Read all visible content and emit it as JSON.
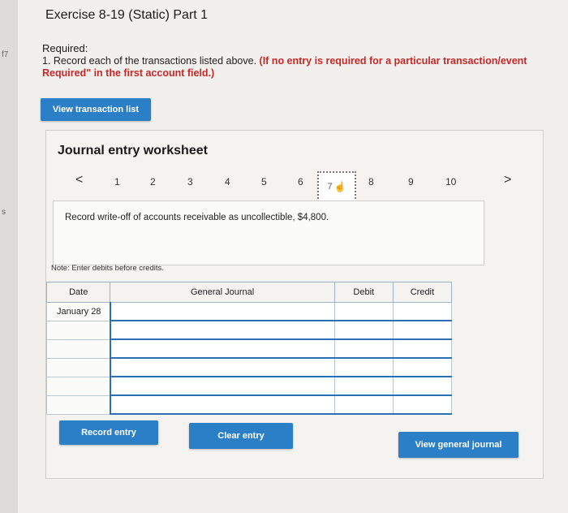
{
  "sidebar": {
    "marks": [
      "f7",
      "s"
    ]
  },
  "title": "Exercise 8-19 (Static) Part 1",
  "required": {
    "label": "Required:",
    "text": "1. Record each of the transactions listed above.",
    "emphasis": "(If no entry is required for a particular transaction/event",
    "line2": "Required\" in the first account field.)"
  },
  "buttons": {
    "view_transactions": "View transaction list",
    "record_entry": "Record entry",
    "clear_entry": "Clear entry",
    "view_general_journal": "View general journal"
  },
  "worksheet": {
    "title": "Journal entry worksheet",
    "prev_arrow": "<",
    "next_arrow": ">",
    "pages": [
      "1",
      "2",
      "3",
      "4",
      "5",
      "6",
      "7",
      "8",
      "9",
      "10"
    ],
    "active_page": "7",
    "description": "Record write-off of accounts receivable as uncollectible, $4,800.",
    "note": "Note: Enter debits before credits."
  },
  "table": {
    "headers": {
      "date": "Date",
      "general_journal": "General Journal",
      "debit": "Debit",
      "credit": "Credit"
    },
    "rows": [
      {
        "date": "January 28"
      },
      {
        "date": ""
      },
      {
        "date": ""
      },
      {
        "date": ""
      },
      {
        "date": ""
      },
      {
        "date": ""
      }
    ]
  },
  "colors": {
    "accent": "#2a7fc6",
    "row_border": "#2b6fb6"
  }
}
